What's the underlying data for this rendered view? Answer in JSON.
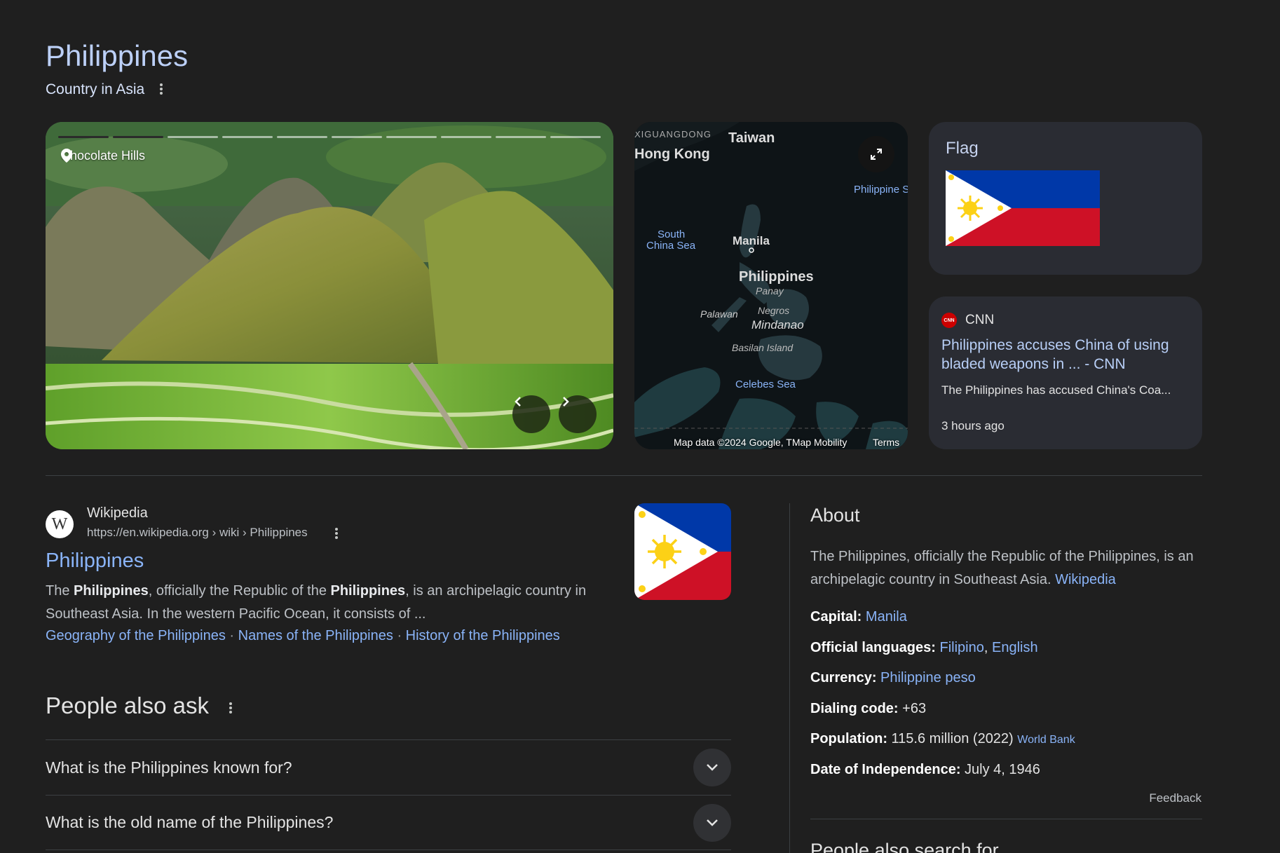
{
  "header": {
    "title": "Philippines",
    "subtitle": "Country in Asia"
  },
  "gallery": {
    "location": "Chocolate Hills",
    "slides_total": 10,
    "slides_viewed": 2
  },
  "map": {
    "labels": {
      "guangdong": "XIGUANGDONG",
      "taiwan": "Taiwan",
      "hongkong": "Hong Kong",
      "philippine_sea": "Philippine S",
      "south_china_sea_1": "South",
      "south_china_sea_2": "China Sea",
      "manila": "Manila",
      "philippines": "Philippines",
      "panay": "Panay",
      "palawan": "Palawan",
      "negros": "Negros",
      "mindanao": "Mindanao",
      "basilan": "Basilan Island",
      "celebes": "Celebes Sea"
    },
    "attribution": "Map data ©2024 Google, TMap Mobility",
    "terms": "Terms"
  },
  "flag_card": {
    "title": "Flag"
  },
  "news": {
    "source": "CNN",
    "source_logo": "CNN",
    "headline": "Philippines accuses China of using bladed weapons in ... - CNN",
    "snippet": "The Philippines has accused China's Coa...",
    "time": "3 hours ago"
  },
  "wiki": {
    "logo": "W",
    "site": "Wikipedia",
    "url": "https://en.wikipedia.org › wiki › Philippines",
    "title": "Philippines",
    "snippet_parts": [
      "The ",
      "Philippines",
      ", officially the Republic of the ",
      "Philippines",
      ", is an archipelagic country in Southeast Asia. In the western Pacific Ocean, it consists of ..."
    ],
    "links": [
      "Geography of the Philippines",
      "Names of the Philippines",
      "History of the Philippines"
    ],
    "sep": "·"
  },
  "paa": {
    "title": "People also ask",
    "questions": [
      "What is the Philippines known for?",
      "What is the old name of the Philippines?"
    ]
  },
  "about": {
    "title": "About",
    "text": "The Philippines, officially the Republic of the Philippines, is an archipelagic country in Southeast Asia.",
    "source": "Wikipedia",
    "facts": {
      "capital": {
        "label": "Capital:",
        "value": "Manila"
      },
      "languages": {
        "label": "Official languages:",
        "value1": "Filipino",
        "sep": ",",
        "value2": "English"
      },
      "currency": {
        "label": "Currency:",
        "value": "Philippine peso"
      },
      "dialing": {
        "label": "Dialing code:",
        "value": "+63"
      },
      "population": {
        "label": "Population:",
        "value": "115.6 million (2022)",
        "source": "World Bank"
      },
      "independence": {
        "label": "Date of Independence:",
        "value": "July 4, 1946"
      }
    },
    "feedback": "Feedback",
    "also_search": "People also search for"
  },
  "colors": {
    "background": "#1f1f1f",
    "link": "#8ab4f8",
    "card": "#2a2c33",
    "title": "#bcd0f8",
    "flag_blue": "#0038a8",
    "flag_red": "#ce1126",
    "flag_sun": "#fcd116"
  }
}
